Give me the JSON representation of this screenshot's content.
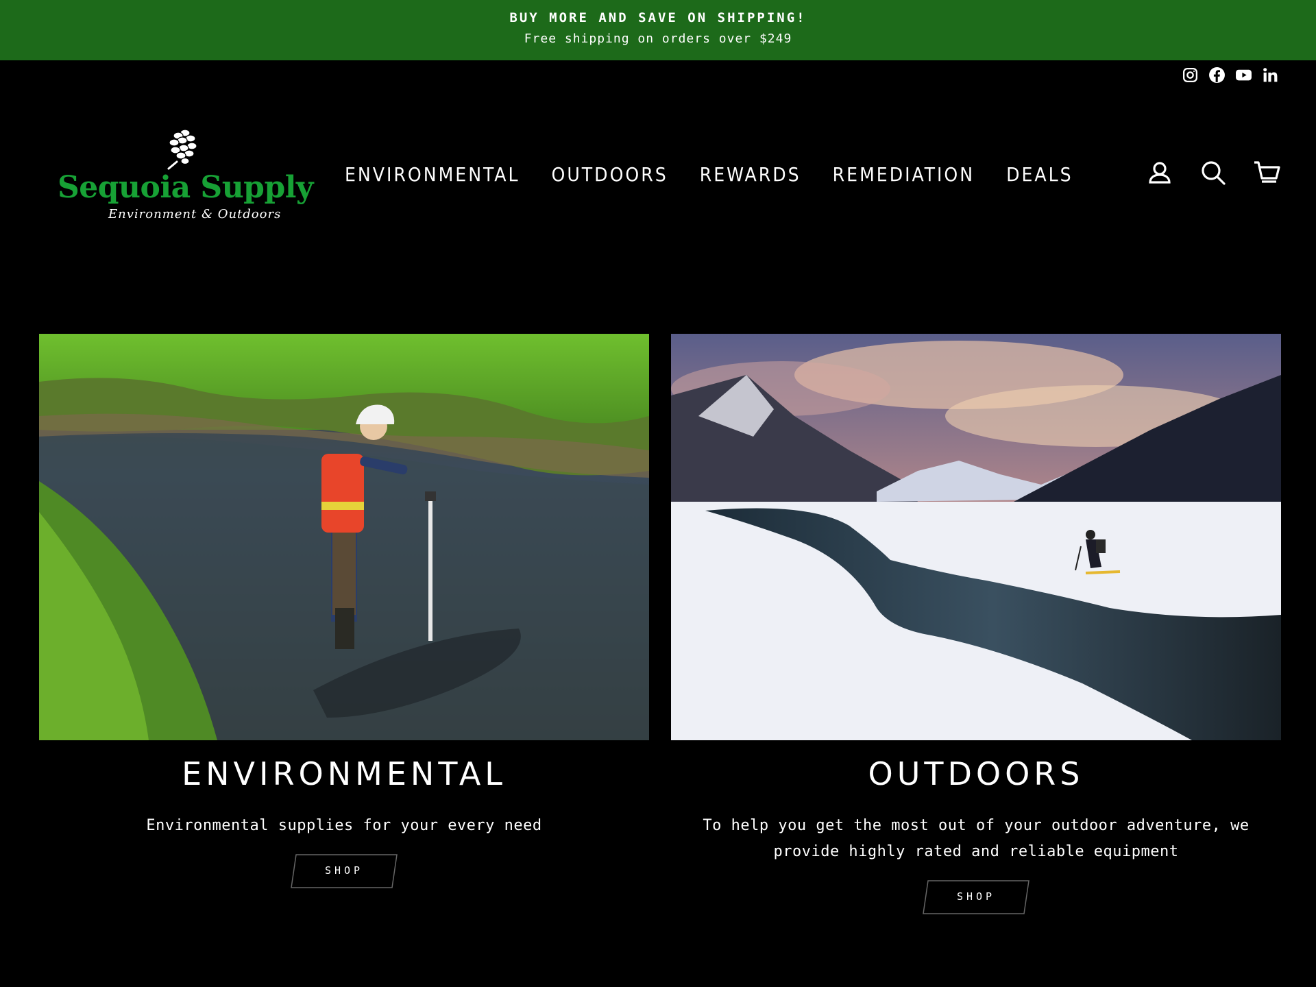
{
  "announcement": {
    "title": "BUY MORE AND SAVE ON SHIPPING!",
    "subtitle": "Free shipping on orders over $249"
  },
  "social": [
    "instagram-icon",
    "facebook-icon",
    "youtube-icon",
    "linkedin-icon"
  ],
  "logo": {
    "name": "Sequoia Supply",
    "tagline": "Environment & Outdoors"
  },
  "nav": {
    "items": [
      "ENVIRONMENTAL",
      "OUTDOORS",
      "REWARDS",
      "REMEDIATION",
      "DEALS"
    ]
  },
  "header_icons": [
    "account-icon",
    "search-icon",
    "cart-icon"
  ],
  "promos": [
    {
      "title": "ENVIRONMENTAL",
      "text": "Environmental supplies for your every need",
      "button": "SHOP"
    },
    {
      "title": "OUTDOORS",
      "text": "To help you get the most out of your outdoor adventure, we provide highly rated and reliable equipment",
      "button": "SHOP"
    }
  ],
  "colors": {
    "announcement_bg": "#1d6a1a",
    "logo_green": "#17a135",
    "page_bg": "#000000"
  }
}
